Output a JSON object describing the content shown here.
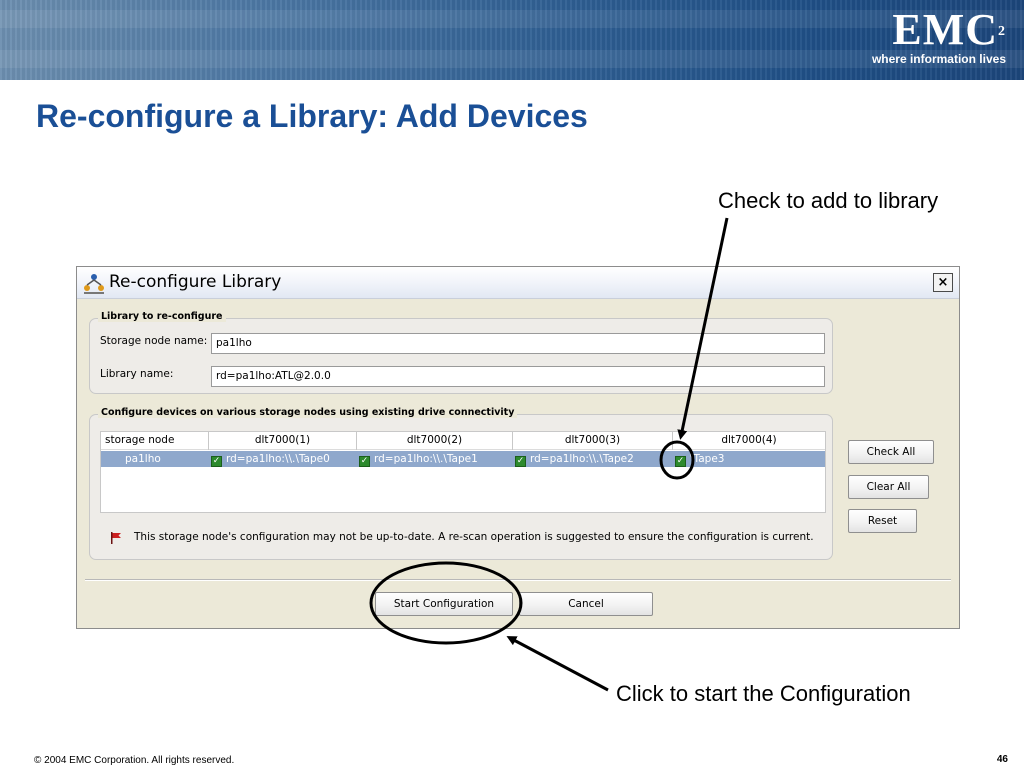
{
  "slide": {
    "title": "Re-configure a Library: Add Devices",
    "callout_check": "Check to add to library",
    "callout_start": "Click to start the Configuration",
    "footer": "© 2004 EMC Corporation. All rights reserved.",
    "page_number": "46"
  },
  "brand": {
    "logo": "EMC",
    "logo_sup": "2",
    "tagline": "where information lives"
  },
  "dialog": {
    "title": "Re-configure Library",
    "close_label": "×",
    "library_group_label": "Library to re-configure",
    "storage_node_label": "Storage node name:",
    "storage_node_value": "pa1lho",
    "library_name_label": "Library name:",
    "library_name_value": "rd=pa1lho:ATL@2.0.0",
    "devices_group_label": "Configure devices on various storage nodes using existing drive connectivity",
    "table": {
      "columns": [
        "storage node",
        "dlt7000(1)",
        "dlt7000(2)",
        "dlt7000(3)",
        "dlt7000(4)"
      ],
      "row": {
        "node": "pa1lho",
        "devices": [
          {
            "label": "rd=pa1lho:\\\\.\\Tape0",
            "checked": true
          },
          {
            "label": "rd=pa1lho:\\\\.\\Tape1",
            "checked": true
          },
          {
            "label": "rd=pa1lho:\\\\.\\Tape2",
            "checked": true
          },
          {
            "label": "\\Tape3",
            "checked": true
          }
        ]
      }
    },
    "warning": "This storage node's configuration may not be up-to-date.  A re-scan operation is suggested to ensure the configuration is current.",
    "buttons": {
      "check_all": "Check All",
      "clear_all": "Clear All",
      "reset": "Reset",
      "start": "Start Configuration",
      "cancel": "Cancel"
    }
  },
  "colors": {
    "title": "#1a4f96",
    "selection": "#8fa8cc",
    "annotation": "#000000"
  }
}
